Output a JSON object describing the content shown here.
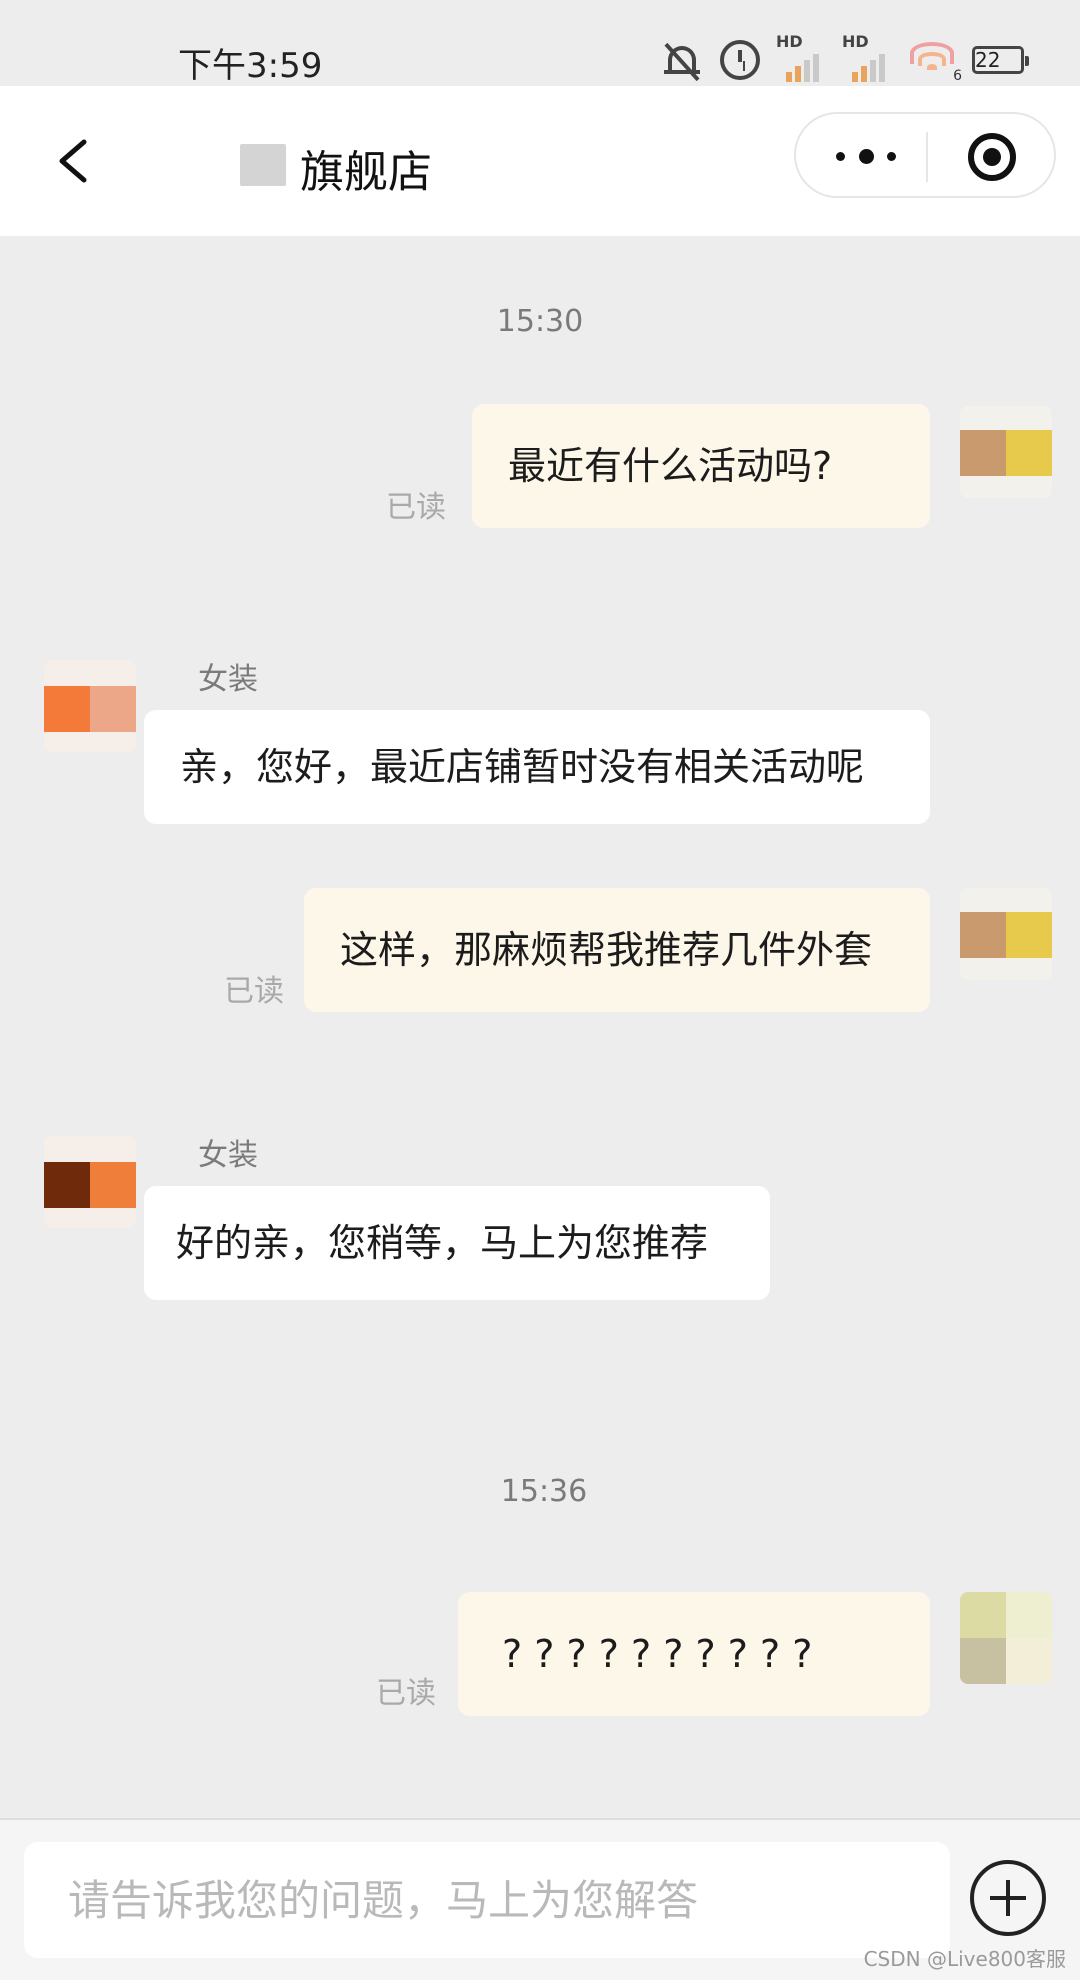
{
  "status_bar": {
    "time": "下午3:59",
    "icons": [
      "mute-bell-icon",
      "alarm-icon",
      "hd-signal-icon",
      "hd-signal-icon",
      "wifi-icon",
      "battery-icon"
    ],
    "hd_label": "HD",
    "wifi_badge": "6",
    "battery": "22"
  },
  "nav": {
    "title": "旗舰店"
  },
  "chat": {
    "messages": [
      {
        "type": "timestamp",
        "text": "15:30"
      },
      {
        "type": "me",
        "text": "最近有什么活动吗?",
        "read": "已读"
      },
      {
        "type": "them",
        "sender": "女装",
        "text": "亲，您好，最近店铺暂时没有相关活动呢"
      },
      {
        "type": "me",
        "text": "这样，那麻烦帮我推荐几件外套",
        "read": "已读"
      },
      {
        "type": "them",
        "sender": "女装",
        "text": "好的亲，您稍等，马上为您推荐"
      },
      {
        "type": "timestamp",
        "text": "15:36"
      },
      {
        "type": "me",
        "text": "? ? ? ? ? ? ? ? ? ?",
        "read": "已读"
      }
    ]
  },
  "input": {
    "placeholder": "请告诉我您的问题，马上为您解答",
    "value": ""
  },
  "watermark": "CSDN @Live800客服",
  "colors": {
    "background": "#ededed",
    "my_bubble": "#fdf7ea",
    "their_bubble": "#ffffff"
  }
}
